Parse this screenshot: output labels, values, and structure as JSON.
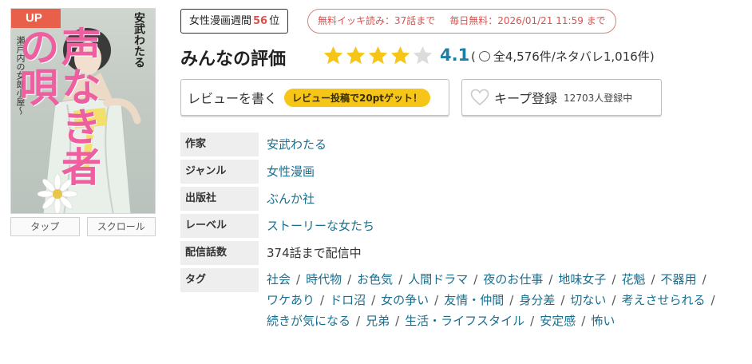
{
  "cover": {
    "badge": "UP",
    "author_vertical": "安武わたる",
    "series_vertical": "瀬戸内の女郎小屋〜",
    "title_vertical": "声なき者の唄",
    "tabs": [
      "タップ",
      "スクロール"
    ]
  },
  "ranking": {
    "label": "女性漫画週間",
    "rank": "56",
    "unit": "位"
  },
  "free_info": {
    "binge": "無料イッキ読み：37話まで",
    "daily": "毎日無料：2026/01/21 11:59 まで"
  },
  "rating": {
    "title": "みんなの評価",
    "score": "4.1",
    "stars_filled": 4,
    "stars_total": 5,
    "review_text": "全4,576件/ネタバレ1,016件",
    "open_paren": "(",
    "close_paren": ")"
  },
  "actions": {
    "review_label": "レビューを書く",
    "review_bonus": "レビュー投稿で20ptゲット！",
    "keep_label": "キープ登録",
    "keep_count": "12703人登録中"
  },
  "info": {
    "author_label": "作家",
    "author": "安武わたる",
    "genre_label": "ジャンル",
    "genre": "女性漫画",
    "publisher_label": "出版社",
    "publisher": "ぶんか社",
    "label_label": "レーベル",
    "label": "ストーリーな女たち",
    "episodes_label": "配信話数",
    "episodes": "374話まで配信中",
    "tags_label": "タグ",
    "tags": [
      "社会",
      "時代物",
      "お色気",
      "人間ドラマ",
      "夜のお仕事",
      "地味女子",
      "花魁",
      "不器用",
      "ワケあり",
      "ドロ沼",
      "女の争い",
      "友情・仲間",
      "身分差",
      "切ない",
      "考えさせられる",
      "続きが気になる",
      "兄弟",
      "生活・ライフスタイル",
      "安定感",
      "怖い"
    ],
    "tag_separator": "/"
  },
  "colors": {
    "accent_link": "#1a6f8f",
    "star": "#f5c518",
    "rank_red": "#d9534f",
    "score_blue": "#1d7fa6"
  }
}
